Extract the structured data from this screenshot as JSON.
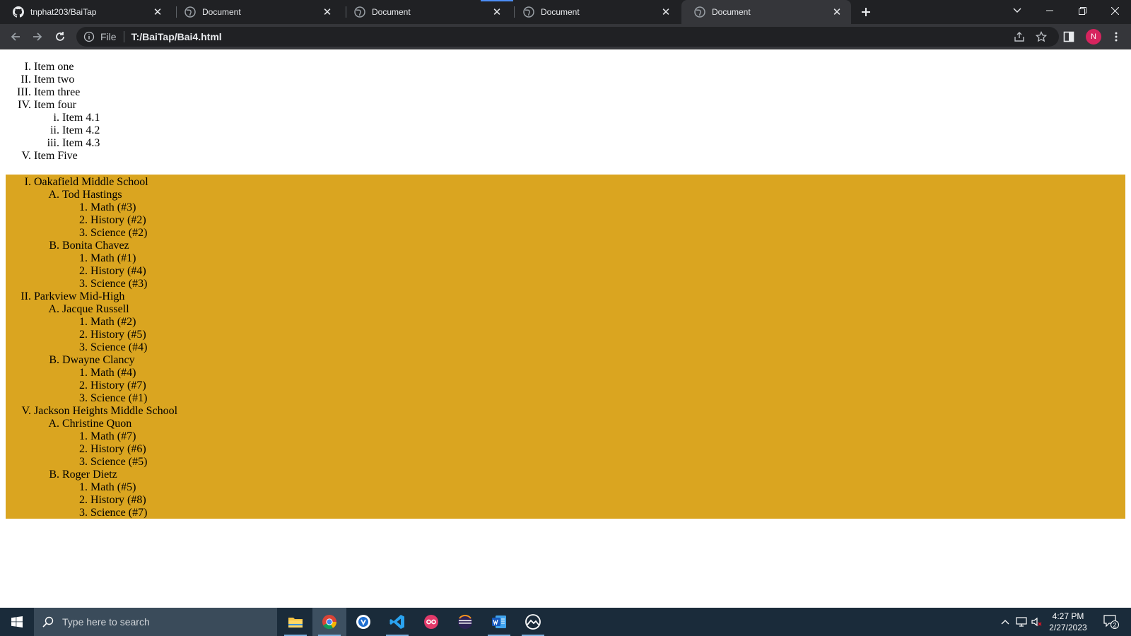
{
  "browser": {
    "tabs": [
      {
        "title": "tnphat203/BaiTap",
        "favicon": "github-icon",
        "active": false
      },
      {
        "title": "Document",
        "favicon": "globe-icon",
        "active": false
      },
      {
        "title": "Document",
        "favicon": "globe-icon",
        "active": false
      },
      {
        "title": "Document",
        "favicon": "globe-icon",
        "active": false
      },
      {
        "title": "Document",
        "favicon": "globe-icon",
        "active": true
      }
    ],
    "address": {
      "scheme_label": "File",
      "url": "T:/BaiTap/Bai4.html"
    },
    "profile_initial": "N"
  },
  "list1": {
    "items": [
      "Item one",
      "Item two",
      "Item three",
      "Item four",
      "Item Five"
    ],
    "sub_items": [
      "Item 4.1",
      "Item 4.2",
      "Item 4.3"
    ]
  },
  "schools": {
    "start_numbers": [
      1,
      2,
      5
    ],
    "items": [
      {
        "name": "Oakafield Middle School",
        "teachers": [
          {
            "name": "Tod Hastings",
            "classes": [
              "Math (#3)",
              "History (#2)",
              "Science (#2)"
            ]
          },
          {
            "name": "Bonita Chavez",
            "classes": [
              "Math (#1)",
              "History (#4)",
              "Science (#3)"
            ]
          }
        ]
      },
      {
        "name": "Parkview Mid-High",
        "teachers": [
          {
            "name": "Jacque Russell",
            "classes": [
              "Math (#2)",
              "History (#5)",
              "Science (#4)"
            ]
          },
          {
            "name": "Dwayne Clancy",
            "classes": [
              "Math (#4)",
              "History (#7)",
              "Science (#1)"
            ]
          }
        ]
      },
      {
        "name": "Jackson Heights Middle School",
        "teachers": [
          {
            "name": "Christine Quon",
            "classes": [
              "Math (#7)",
              "History (#6)",
              "Science (#5)"
            ]
          },
          {
            "name": "Roger Dietz",
            "classes": [
              "Math (#5)",
              "History (#8)",
              "Science (#7)"
            ]
          }
        ]
      }
    ],
    "background_color": "#daa520"
  },
  "taskbar": {
    "search_placeholder": "Type here to search",
    "time": "4:27 PM",
    "date": "2/27/2023",
    "notification_count": "2"
  }
}
